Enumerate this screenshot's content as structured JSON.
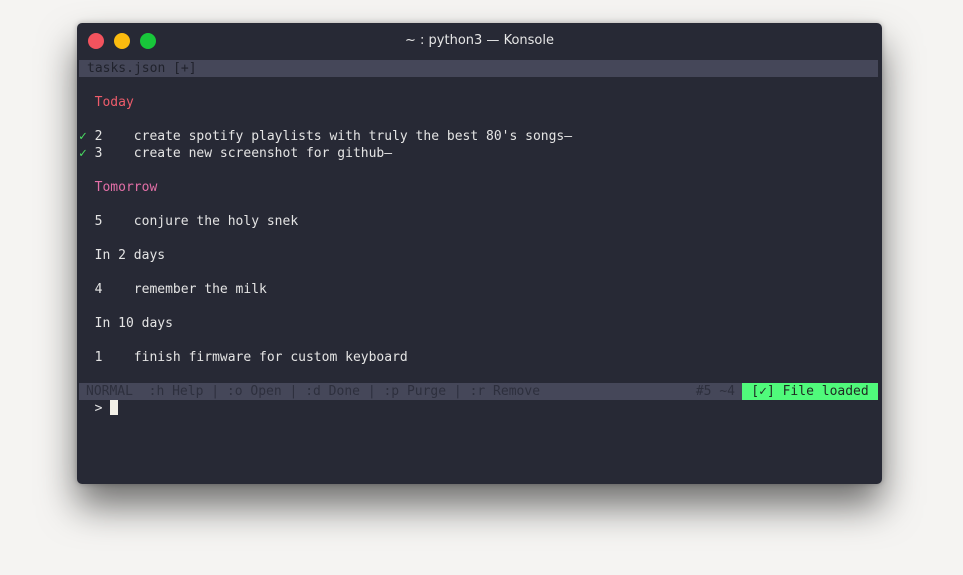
{
  "window": {
    "title": "~ : python3 — Konsole"
  },
  "tab": {
    "label": "tasks.json [+]"
  },
  "groups": [
    {
      "heading": "Today",
      "tasks": [
        {
          "done": true,
          "check": "✓",
          "id": "2",
          "text": "create spotify playlists with truly the best 80's songs—"
        },
        {
          "done": true,
          "check": "✓",
          "id": "3",
          "text": "create new screenshot for github—"
        }
      ]
    },
    {
      "heading": "Tomorrow",
      "tasks": [
        {
          "done": false,
          "check": "",
          "id": "5",
          "text": "conjure the holy snek"
        }
      ]
    },
    {
      "heading": "In 2 days",
      "tasks": [
        {
          "done": false,
          "check": "",
          "id": "4",
          "text": "remember the milk"
        }
      ]
    },
    {
      "heading": "In 10 days",
      "tasks": [
        {
          "done": false,
          "check": "",
          "id": "1",
          "text": "finish firmware for custom keyboard"
        }
      ]
    }
  ],
  "statusbar": {
    "mode": "NORMAL",
    "help": ":h Help",
    "open": ":o Open",
    "done": ":d Done",
    "purge": ":p Purge",
    "remove": ":r Remove",
    "separator": "|",
    "counts": "#5 ~4",
    "message": "[✓] File loaded"
  },
  "prompt": {
    "symbol": ">",
    "value": ""
  },
  "colors": {
    "today": "#ee5c6b",
    "tomorrow": "#e36fa7",
    "check": "#4ade62",
    "message_bg": "#50fa7b",
    "terminal_bg": "#272935"
  }
}
